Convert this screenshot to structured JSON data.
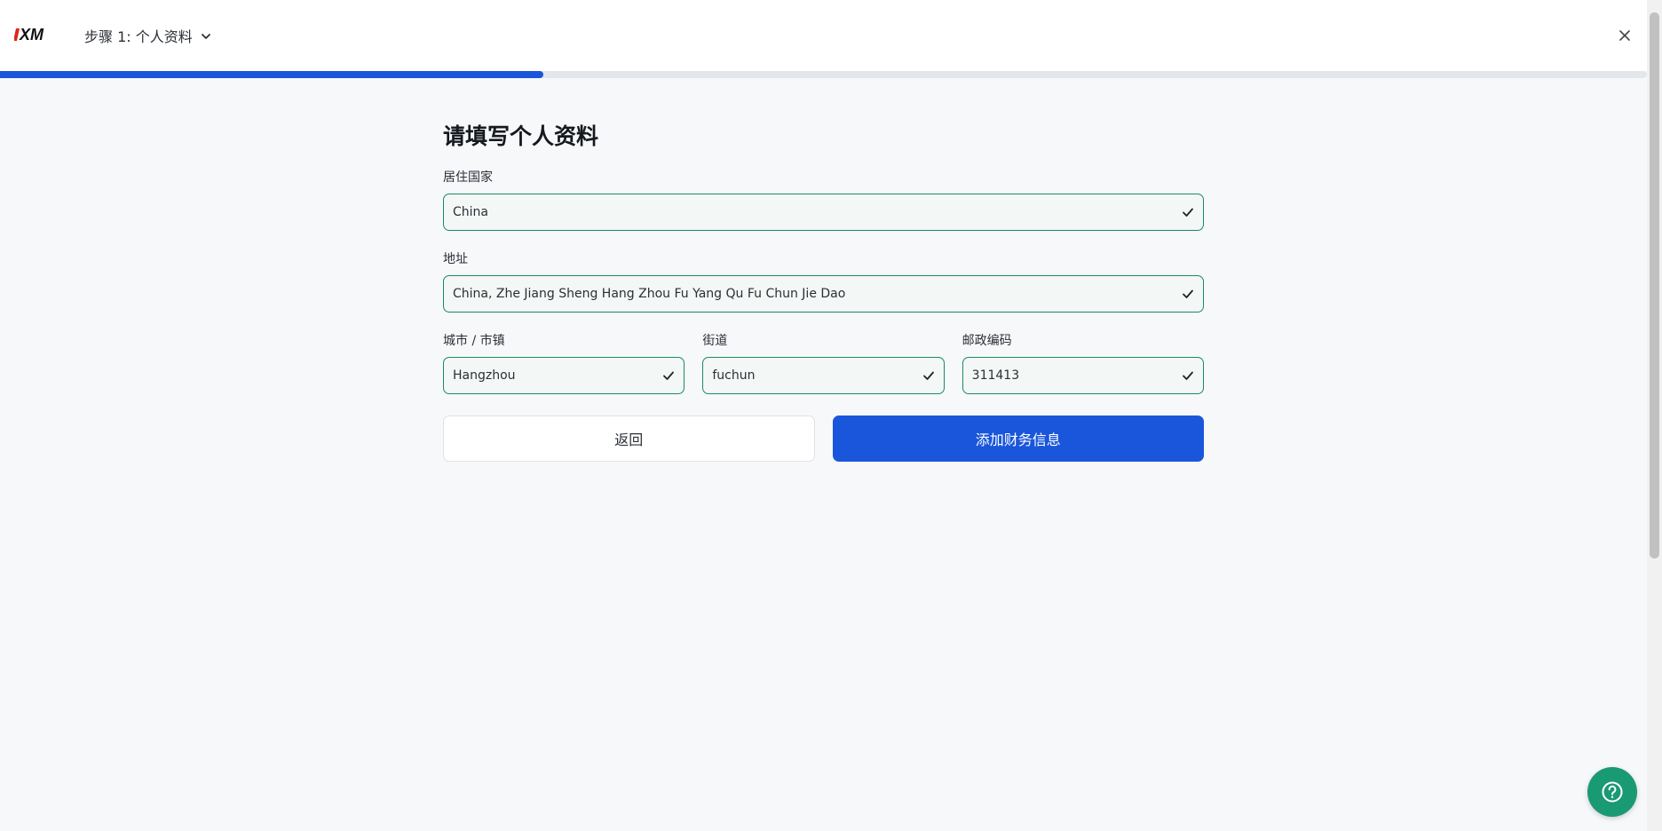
{
  "header": {
    "logo_text": "XM",
    "step_title": "步骤 1: 个人资料",
    "icons": {
      "step_toggle": "chevron-down-icon",
      "close": "close-icon"
    },
    "progress": 0.33
  },
  "form": {
    "heading": "请填写个人资料",
    "fields": {
      "country": {
        "label": "居住国家",
        "value": "China"
      },
      "address": {
        "label": "地址",
        "value": "China, Zhe Jiang Sheng Hang Zhou Fu Yang Qu Fu Chun Jie Dao"
      },
      "city": {
        "label": "城市 / 市镇",
        "value": "Hangzhou"
      },
      "street": {
        "label": "街道",
        "value": "fuchun"
      },
      "postcode": {
        "label": "邮政编码",
        "value": "311413"
      }
    },
    "buttons": {
      "back": "返回",
      "next": "添加财务信息"
    }
  },
  "help": {
    "icon": "question-icon"
  },
  "colors": {
    "accent": "#1a56db",
    "valid_border": "#1a8a66",
    "help_button": "#1a9a72",
    "logo_red": "#e2231a"
  }
}
